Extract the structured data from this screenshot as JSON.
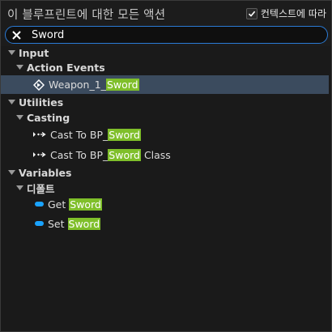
{
  "header": {
    "title": "이 블루프린트에 대한 모든 액션",
    "context_label": "컨텍스트에 따라",
    "context_checked": true
  },
  "search": {
    "value": "Sword"
  },
  "tree": {
    "input_label": "Input",
    "action_events_label": "Action Events",
    "weapon_prefix": "Weapon_1_",
    "weapon_match": "Sword",
    "utilities_label": "Utilities",
    "casting_label": "Casting",
    "cast_prefix": "Cast To BP_",
    "cast_match": "Sword",
    "cast_class_prefix": "Cast To BP_",
    "cast_class_match": "Sword",
    "cast_class_suffix": "Class",
    "variables_label": "Variables",
    "default_label": "디폴트",
    "get_prefix": "Get",
    "get_match": "Sword",
    "set_prefix": "Set",
    "set_match": "Sword"
  },
  "colors": {
    "highlight": "#7fbf2a",
    "selection": "#3b4b5e",
    "search_border": "#2b7bd6",
    "variable_pill": "#1aa3ff"
  },
  "icons": [
    "close-icon",
    "checkmark-icon",
    "triangle-down-icon",
    "event-diamond-icon",
    "cast-exec-icon",
    "variable-pill-icon"
  ]
}
